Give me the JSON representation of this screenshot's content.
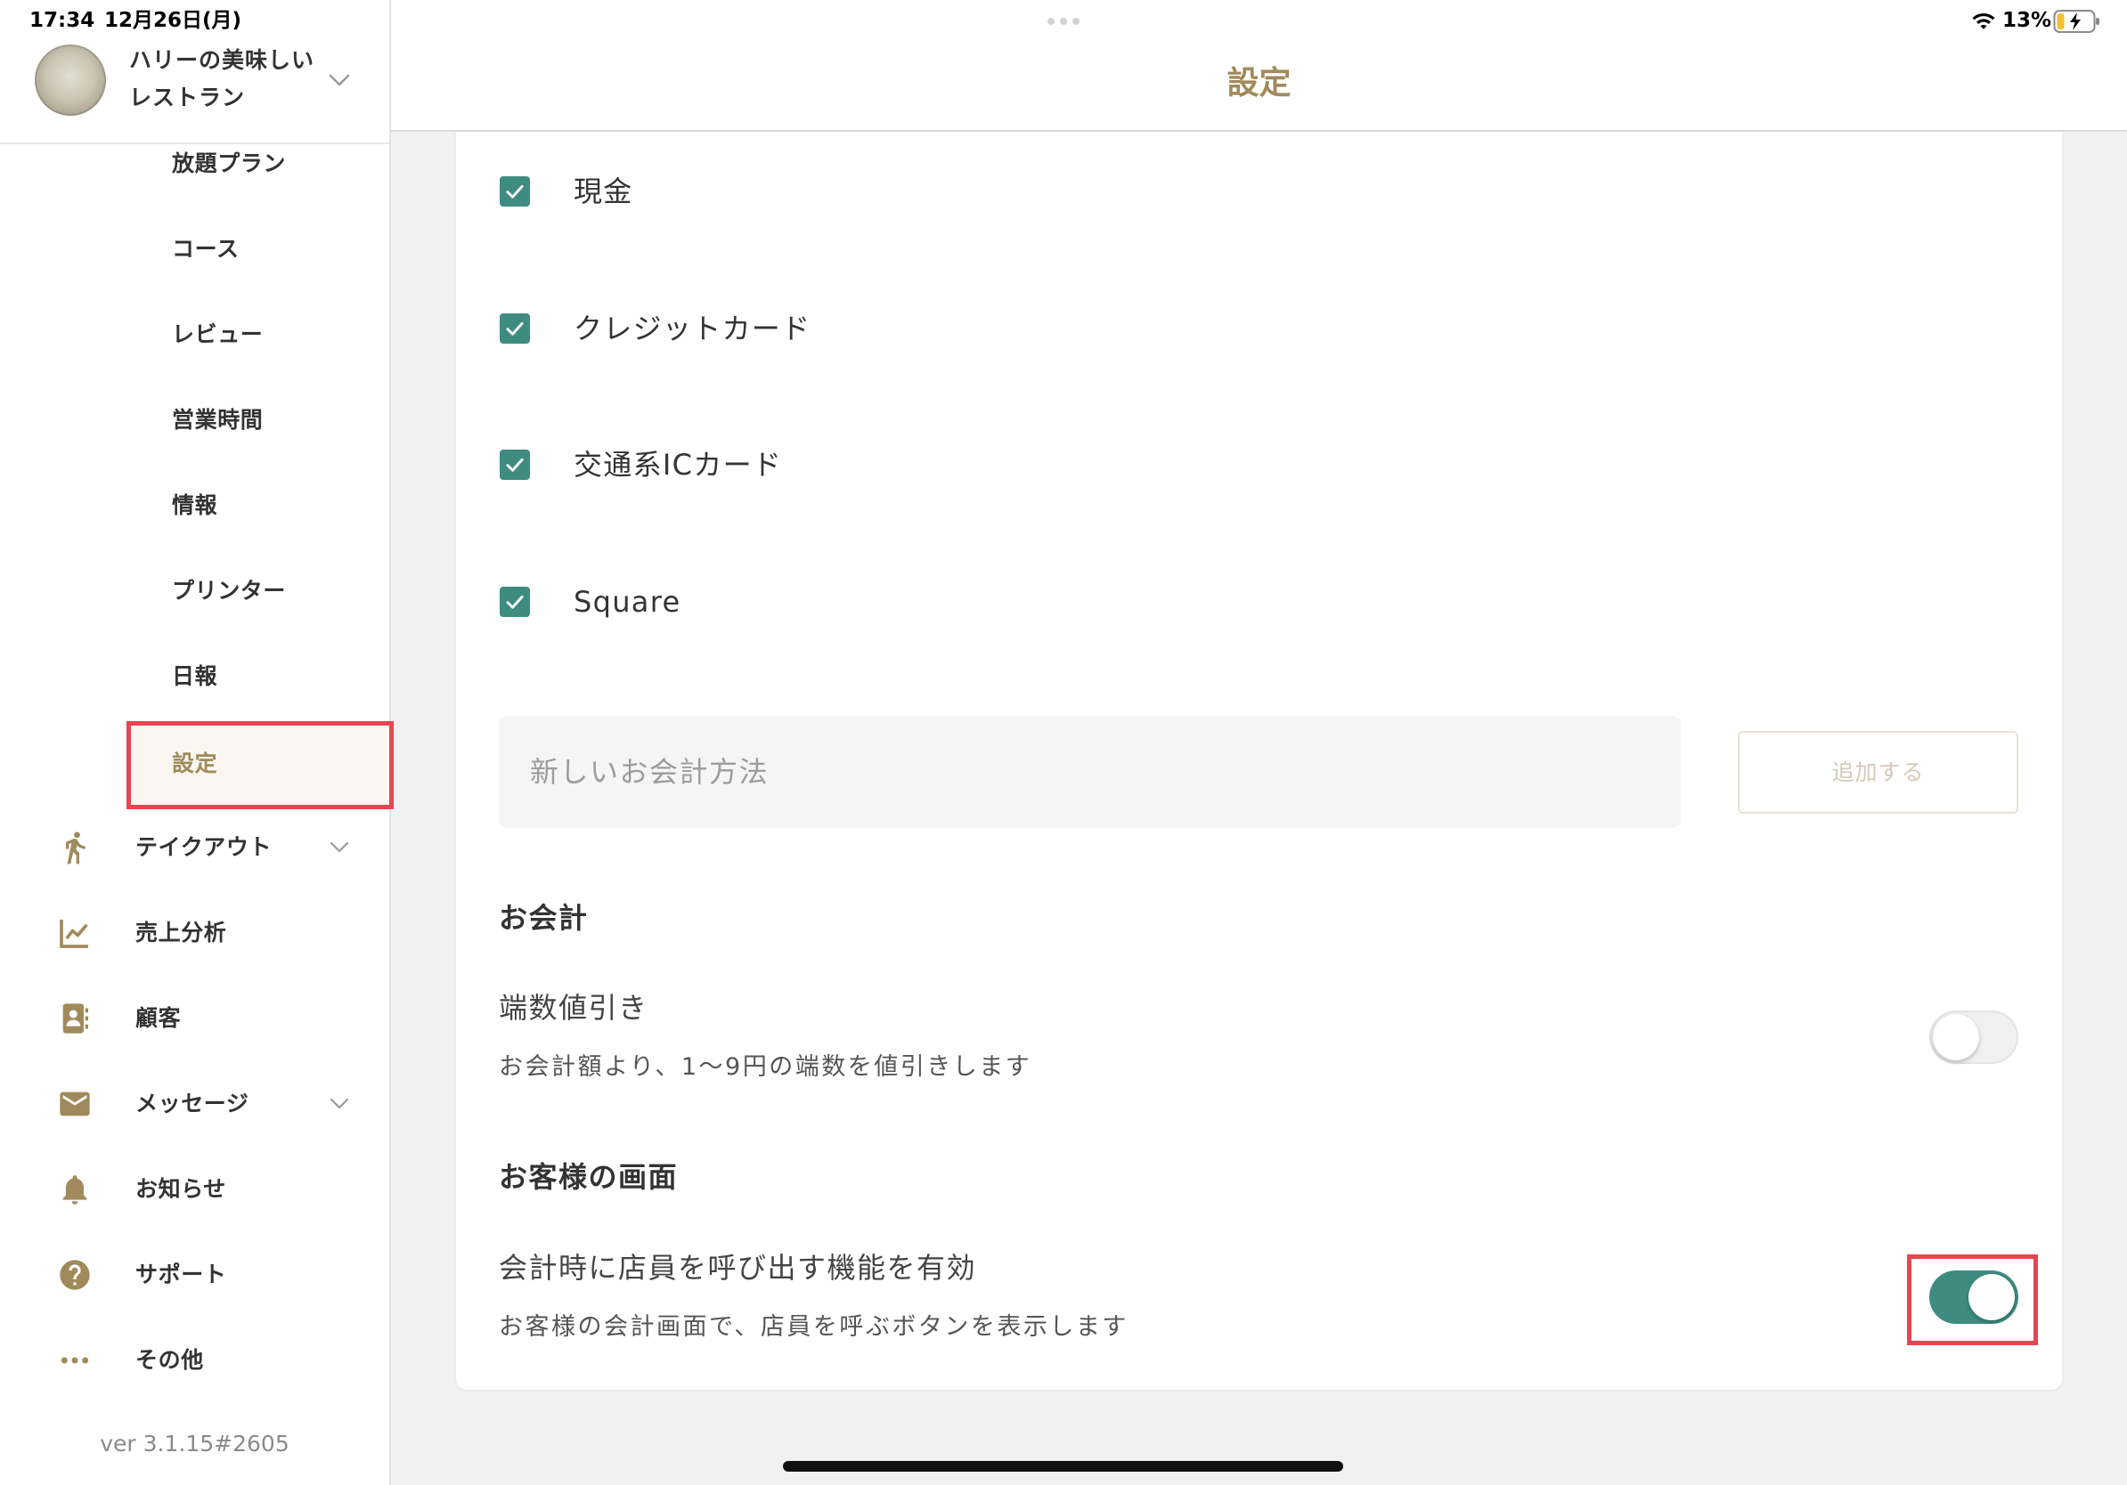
{
  "status_bar": {
    "time": "17:34",
    "date": "12月26日(月)",
    "battery": "13%",
    "icons": [
      "wifi-icon",
      "battery-charging-icon"
    ]
  },
  "sidebar": {
    "restaurant_name_lines": [
      "ハリーの美味しい",
      "レストラン"
    ],
    "sub_items": [
      {
        "label": "放題プラン"
      },
      {
        "label": "コース"
      },
      {
        "label": "レビュー"
      },
      {
        "label": "営業時間"
      },
      {
        "label": "情報"
      },
      {
        "label": "プリンター"
      },
      {
        "label": "日報"
      },
      {
        "label": "設定",
        "selected": true
      }
    ],
    "main_items": [
      {
        "label": "テイクアウト",
        "icon": "walking-person-icon",
        "has_submenu": true
      },
      {
        "label": "売上分析",
        "icon": "line-chart-icon"
      },
      {
        "label": "顧客",
        "icon": "contact-card-icon"
      },
      {
        "label": "メッセージ",
        "icon": "envelope-icon",
        "has_submenu": true
      },
      {
        "label": "お知らせ",
        "icon": "bell-icon"
      },
      {
        "label": "サポート",
        "icon": "help-circle-icon"
      },
      {
        "label": "その他",
        "icon": "more-dots-icon"
      }
    ],
    "version": "ver 3.1.15#2605"
  },
  "header": {
    "title": "設定"
  },
  "payment_methods": [
    {
      "label": "現金",
      "checked": true
    },
    {
      "label": "クレジットカード",
      "checked": true
    },
    {
      "label": "交通系ICカード",
      "checked": true
    },
    {
      "label": "Square",
      "checked": true
    }
  ],
  "new_payment_method": {
    "placeholder": "新しいお会計方法",
    "add_button_label": "追加する"
  },
  "checkout_section": {
    "heading": "お会計",
    "settings": [
      {
        "title": "端数値引き",
        "description": "お会計額より、1〜9円の端数を値引きします",
        "enabled": false
      }
    ]
  },
  "customer_screen_section": {
    "heading": "お客様の画面",
    "settings": [
      {
        "title": "会計時に店員を呼び出す機能を有効",
        "description": "お客様の会計画面で、店員を呼ぶボタンを表示します",
        "enabled": true
      }
    ]
  },
  "colors": {
    "accent_gold": "#a08a5c",
    "teal": "#3d8c7f",
    "highlight_red": "#e5464f"
  }
}
